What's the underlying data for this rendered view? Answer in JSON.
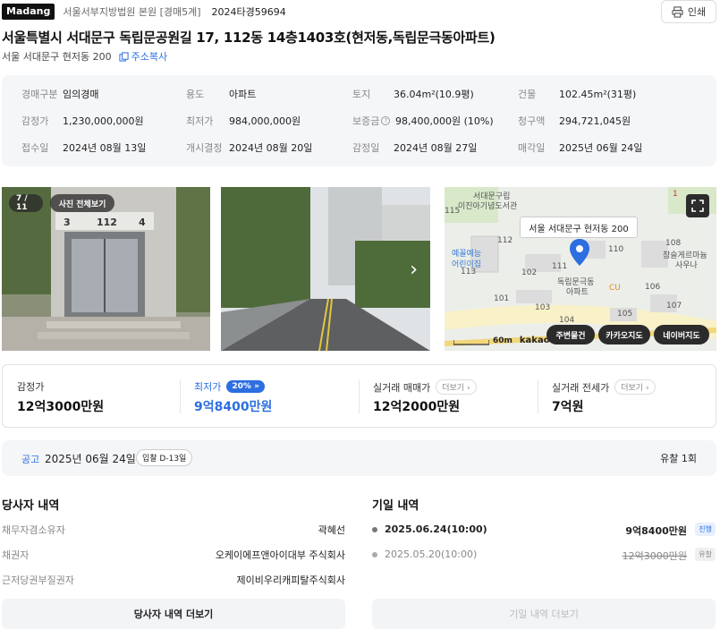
{
  "header": {
    "brand": "Madang",
    "court": "서울서부지방법원 본원 [경매5계]",
    "case_no": "2024타경59694",
    "print_label": "인쇄"
  },
  "title": "서울특별시 서대문구 독립문공원길 17, 112동 14층1403호(현저동,독립문극동아파트)",
  "sub_address": "서울 서대문구 현저동 200",
  "copy_label": "주소복사",
  "info": [
    {
      "label": "경매구분",
      "value": "임의경매"
    },
    {
      "label": "용도",
      "value": "아파트"
    },
    {
      "label": "토지",
      "value": "36.04m²(10.9평)"
    },
    {
      "label": "건물",
      "value": "102.45m²(31평)"
    },
    {
      "label": "감정가",
      "value": "1,230,000,000원"
    },
    {
      "label": "최저가",
      "value": "984,000,000원"
    },
    {
      "label": "보증금",
      "value": "98,400,000원 (10%)"
    },
    {
      "label": "청구액",
      "value": "294,721,045원"
    },
    {
      "label": "접수일",
      "value": "2024년 08월 13일"
    },
    {
      "label": "개시결정",
      "value": "2024년 08월 20일"
    },
    {
      "label": "감정일",
      "value": "2024년 08월 27일"
    },
    {
      "label": "매각일",
      "value": "2025년 06월 24일"
    }
  ],
  "photos": {
    "counter": "7 / 11",
    "view_all": "사진 전체보기",
    "building_sign": [
      "3",
      "112",
      "4"
    ]
  },
  "map": {
    "tooltip": "서울 서대문구 현저동 200",
    "buttons": [
      "주변물건",
      "카카오지도",
      "네이버지도"
    ],
    "scale": "60m",
    "logo": "kakao",
    "labels": [
      "서대문구립",
      "이진아기념도서관",
      "115",
      "112",
      "예꼴예능",
      "어린이집",
      "111",
      "110",
      "108",
      "참슬게르마늄",
      "사우나",
      "113",
      "102",
      "독립문극동",
      "아파트",
      "CU",
      "106",
      "101",
      "103",
      "107",
      "104",
      "105",
      "1"
    ]
  },
  "prices": [
    {
      "label": "감정가",
      "value": "12억3000만원"
    },
    {
      "label": "최저가",
      "value": "9억8400만원",
      "badge": "20%"
    },
    {
      "label": "실거래 매매가",
      "value": "12억2000만원",
      "more": "더보기"
    },
    {
      "label": "실거래 전세가",
      "value": "7억원",
      "more": "더보기"
    }
  ],
  "notice": {
    "label": "공고",
    "date": "2025년 06월 24일",
    "dday": "입찰 D-13일",
    "fail_count": "유찰 1회"
  },
  "parties": {
    "title": "당사자 내역",
    "rows": [
      {
        "label": "채무자겸소유자",
        "value": "곽혜선"
      },
      {
        "label": "채권자",
        "value": "오케이에프앤아이대부 주식회사"
      },
      {
        "label": "근저당권부질권자",
        "value": "제이비우리캐피탈주식회사"
      }
    ],
    "more_label": "당사자 내역 더보기"
  },
  "history": {
    "title": "기일 내역",
    "rows": [
      {
        "date": "2025.06.24(10:00)",
        "amount": "9억8400만원",
        "status": "진행"
      },
      {
        "date": "2025.05.20(10:00)",
        "amount": "12억3000만원",
        "status": "유찰"
      }
    ],
    "more_label": "기일 내역 더보기"
  },
  "colors": {
    "accent": "#2d6ee0",
    "panel": "#f5f6f8"
  }
}
